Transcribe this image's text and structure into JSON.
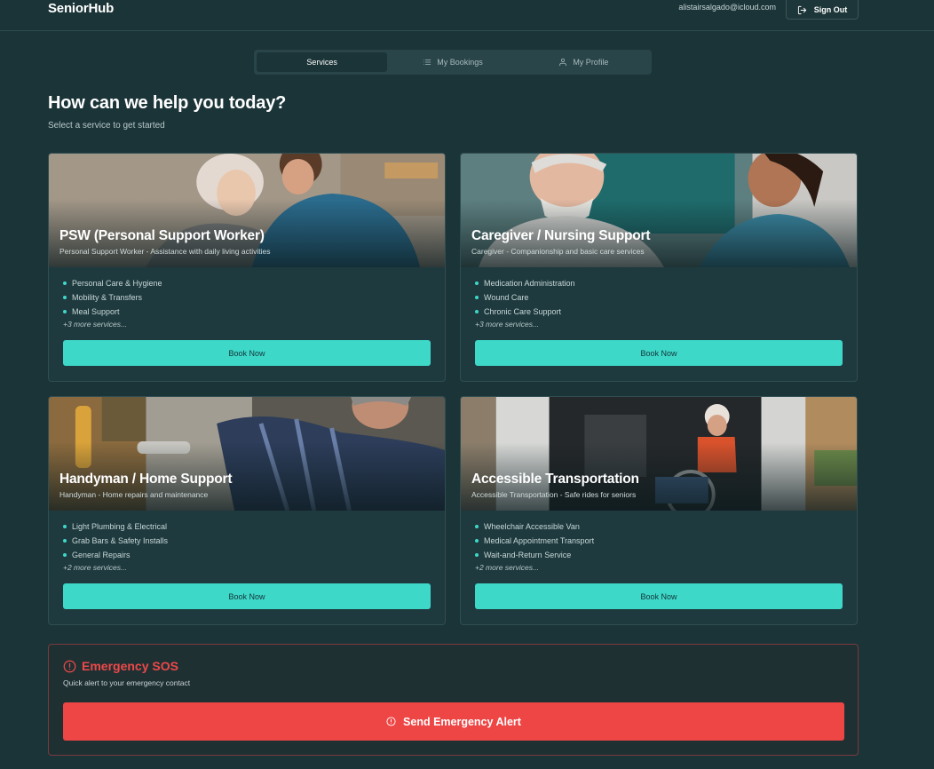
{
  "header": {
    "logo": "SeniorHub",
    "user_email": "alistairsalgado@icloud.com",
    "signout_label": "Sign Out",
    "signout_icon": "logout-icon"
  },
  "tabs": [
    {
      "label": "Services",
      "active": true
    },
    {
      "label": "My Bookings",
      "icon": "list-icon"
    },
    {
      "label": "My Profile",
      "icon": "user-icon"
    }
  ],
  "main": {
    "title": "How can we help you today?",
    "subtitle": "Select a service to get started"
  },
  "services": [
    {
      "title": "PSW (Personal Support Worker)",
      "description": "Personal Support Worker - Assistance with daily living activities",
      "items": [
        "Personal Care & Hygiene",
        "Mobility & Transfers",
        "Meal Support"
      ],
      "more": "+3 more services...",
      "button": "Book Now"
    },
    {
      "title": "Caregiver / Nursing Support",
      "description": "Caregiver - Companionship and basic care services",
      "items": [
        "Medication Administration",
        "Wound Care",
        "Chronic Care Support"
      ],
      "more": "+3 more services...",
      "button": "Book Now"
    },
    {
      "title": "Handyman / Home Support",
      "description": "Handyman - Home repairs and maintenance",
      "items": [
        "Light Plumbing & Electrical",
        "Grab Bars & Safety Installs",
        "General Repairs"
      ],
      "more": "+2 more services...",
      "button": "Book Now"
    },
    {
      "title": "Accessible Transportation",
      "description": "Accessible Transportation - Safe rides for seniors",
      "items": [
        "Wheelchair Accessible Van",
        "Medical Appointment Transport",
        "Wait-and-Return Service"
      ],
      "more": "+2 more services...",
      "button": "Book Now"
    }
  ],
  "emergency": {
    "title": "Emergency SOS",
    "subtitle": "Quick alert to your emergency contact",
    "button": "Send Emergency Alert",
    "icon": "alert-circle-icon"
  },
  "colors": {
    "background": "#1b3438",
    "accent": "#3ed8c9",
    "danger": "#ee4545"
  }
}
